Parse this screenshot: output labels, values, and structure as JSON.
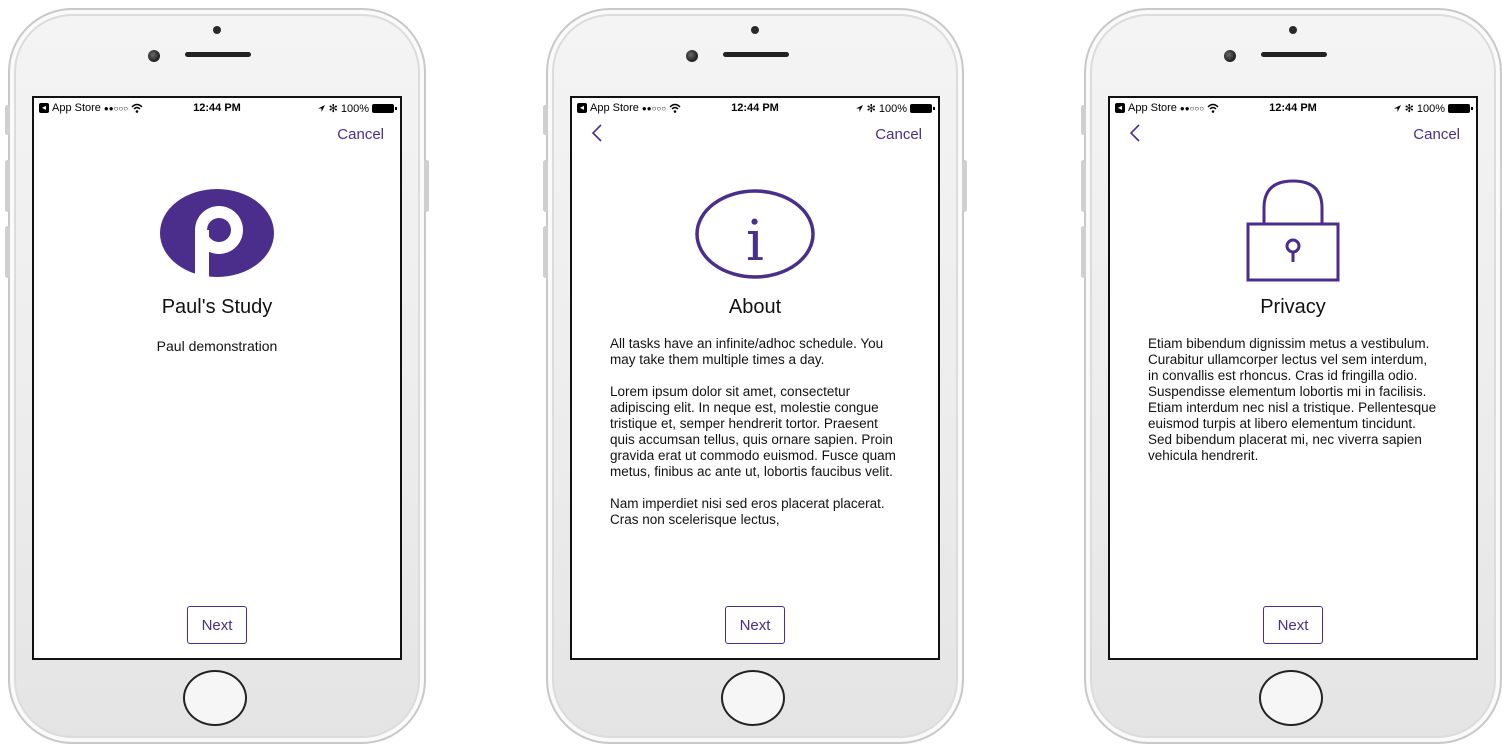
{
  "colors": {
    "accent": "#4b2d8c",
    "bezel": "#ececec",
    "screen": "#ffffff"
  },
  "status_bar": {
    "carrier": "App Store",
    "signal": "●●○○○",
    "wifi_icon": "wifi-icon",
    "time": "12:44 PM",
    "location_icon": "location-arrow-icon",
    "bluetooth": "✻",
    "battery": "100%"
  },
  "screens": [
    {
      "cancel": "Cancel",
      "icon": "study-logo-icon",
      "title": "Paul's Study",
      "subtitle": "Paul demonstration",
      "next": "Next"
    },
    {
      "cancel": "Cancel",
      "back_icon": "chevron-left-icon",
      "icon": "info-icon",
      "icon_glyph": "i",
      "title": "About",
      "paragraphs": [
        "All tasks have an infinite/adhoc schedule. You may take them multiple times a day.",
        "Lorem ipsum dolor sit amet, consectetur adipiscing elit. In neque est, molestie congue tristique et, semper hendrerit tortor. Praesent quis accumsan tellus, quis ornare sapien. Proin gravida erat ut commodo euismod. Fusce quam metus, finibus ac ante ut, lobortis faucibus velit.",
        "Nam imperdiet nisi sed eros placerat placerat. Cras non scelerisque lectus,"
      ],
      "next": "Next"
    },
    {
      "cancel": "Cancel",
      "back_icon": "chevron-left-icon",
      "icon": "lock-icon",
      "title": "Privacy",
      "paragraphs": [
        "Etiam bibendum dignissim metus a vestibulum. Curabitur ullamcorper lectus vel sem interdum, in convallis est rhoncus. Cras id fringilla odio. Suspendisse elementum lobortis mi in facilisis. Etiam interdum nec nisl a tristique. Pellentesque euismod turpis at libero elementum tincidunt. Sed bibendum placerat mi, nec viverra sapien vehicula hendrerit."
      ],
      "next": "Next"
    }
  ]
}
